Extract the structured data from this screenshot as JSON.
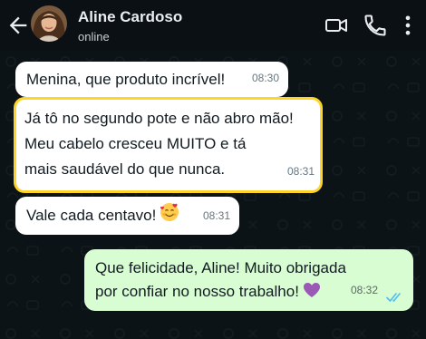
{
  "header": {
    "contact_name": "Aline Cardoso",
    "status": "online",
    "icons": [
      "arrow-left-icon",
      "avatar",
      "video-call-icon",
      "phone-icon",
      "more-vertical-icon"
    ]
  },
  "messages": [
    {
      "direction": "incoming",
      "highlighted": false,
      "lines": [
        "Menina, que produto incrível!"
      ],
      "time": "08:30"
    },
    {
      "direction": "incoming",
      "highlighted": true,
      "lines": [
        "Já tô no segundo pote e não abro mão!",
        "Meu cabelo cresceu MUITO e tá",
        "mais saudável do que nunca."
      ],
      "time": "08:31"
    },
    {
      "direction": "incoming",
      "highlighted": false,
      "lines": [
        "Vale cada centavo!"
      ],
      "emoji": "smiling-face-with-hearts",
      "time": "08:31"
    },
    {
      "direction": "outgoing",
      "highlighted": false,
      "lines": [
        "Que felicidade, Aline! Muito obrigada",
        "por confiar no nosso trabalho!"
      ],
      "emoji": "purple-heart",
      "time": "08:32",
      "receipt": "read-double-check"
    }
  ],
  "colors": {
    "chat_background": "#0c1317",
    "incoming_bubble": "#ffffff",
    "outgoing_bubble": "#d9fdd3",
    "highlight_border": "#ffd426",
    "read_check": "#53bdeb"
  }
}
